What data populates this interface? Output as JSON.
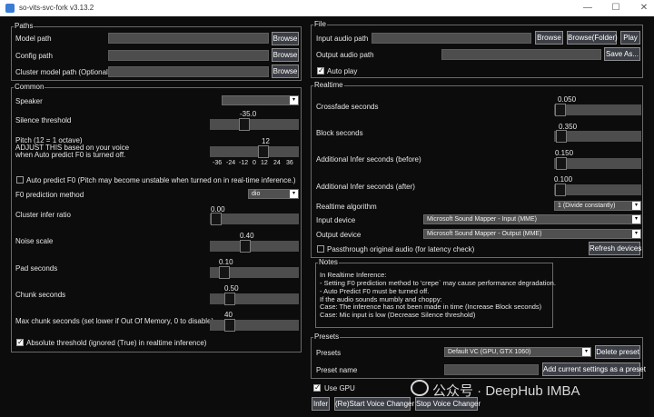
{
  "window": {
    "title": "so-vits-svc-fork v3.13.2",
    "controls": [
      "—",
      "☐",
      "✕"
    ]
  },
  "paths": {
    "legend": "Paths",
    "model_path": "Model path",
    "config_path": "Config path",
    "cluster_path": "Cluster model path (Optional)",
    "browse": "Browse"
  },
  "file": {
    "legend": "File",
    "input_audio": "Input audio path",
    "output_audio": "Output audio path",
    "browse": "Browse",
    "browse_folder": "Browse(Folder)",
    "play": "Play",
    "save_as": "Save As...",
    "auto_play": "Auto play"
  },
  "common": {
    "legend": "Common",
    "speaker": "Speaker",
    "silence_threshold": "Silence threshold",
    "silence_value": "-35.0",
    "pitch_label_1": "Pitch (12 = 1 octave)",
    "pitch_label_2": "ADJUST THIS based on your voice",
    "pitch_label_3": "when Auto predict F0 is turned off.",
    "pitch_value": "12",
    "pitch_ticks": [
      "-36",
      "-24",
      "-12",
      "0",
      "12",
      "24",
      "36"
    ],
    "auto_predict": "Auto predict F0 (Pitch may become unstable when turned on in real-time inference.)",
    "f0_method": "F0 prediction method",
    "f0_value": "dio",
    "cluster_ratio": "Cluster infer ratio",
    "cluster_value": "0.00",
    "noise_scale": "Noise scale",
    "noise_value": "0.40",
    "pad_seconds": "Pad seconds",
    "pad_value": "0.10",
    "chunk_seconds": "Chunk seconds",
    "chunk_value": "0.50",
    "max_chunk": "Max chunk seconds (set lower if Out Of Memory, 0 to disable)",
    "max_chunk_value": "40",
    "absolute_threshold": "Absolute threshold (ignored (True) in realtime inference)"
  },
  "realtime": {
    "legend": "Realtime",
    "crossfade": "Crossfade seconds",
    "crossfade_value": "0.050",
    "block": "Block seconds",
    "block_value": "0.350",
    "infer_before": "Additional Infer seconds (before)",
    "infer_before_value": "0.150",
    "infer_after": "Additional Infer seconds (after)",
    "infer_after_value": "0.100",
    "algorithm": "Realtime algorithm",
    "algorithm_value": "1 (Divide constantly)",
    "input_device": "Input device",
    "input_device_value": "Microsoft Sound Mapper - Input (MME)",
    "output_device": "Output device",
    "output_device_value": "Microsoft Sound Mapper - Output (MME)",
    "passthrough": "Passthrough original audio (for latency check)",
    "refresh": "Refresh devices"
  },
  "notes": {
    "legend": "Notes",
    "lines": [
      "In Realtime Inference:",
      "    - Setting F0 prediction method to 'crepe` may cause performance degradation.",
      "    - Auto Predict F0 must be turned off.",
      "If the audio sounds mumbly and choppy:",
      "    Case: The inference has not been made in time (Increase Block seconds)",
      "    Case: Mic input is low (Decrease Silence threshold)"
    ]
  },
  "presets": {
    "legend": "Presets",
    "presets_label": "Presets",
    "preset_value": "Default VC (GPU, GTX 1060)",
    "delete": "Delete preset",
    "preset_name": "Preset name",
    "add": "Add current settings as a preset"
  },
  "bottom": {
    "use_gpu": "Use GPU",
    "infer": "Infer",
    "restart": "(Re)Start Voice Changer",
    "stop": "Stop Voice Changer"
  },
  "watermark": "公众号 · DeepHub IMBA",
  "icons": [
    "app-icon",
    "minimize-icon",
    "maximize-icon",
    "close-icon",
    "dropdown-arrow-icon",
    "checkmark-icon",
    "wechat-icon"
  ],
  "sliders": {
    "silence_threshold": -35.0,
    "pitch": 12,
    "cluster_infer_ratio": 0.0,
    "noise_scale": 0.4,
    "pad_seconds": 0.1,
    "chunk_seconds": 0.5,
    "max_chunk_seconds": 40,
    "crossfade_seconds": 0.05,
    "block_seconds": 0.35,
    "infer_before": 0.15,
    "infer_after": 0.1
  },
  "checkboxes": {
    "auto_play": true,
    "auto_predict": false,
    "absolute_threshold": true,
    "passthrough": false,
    "use_gpu": true
  }
}
